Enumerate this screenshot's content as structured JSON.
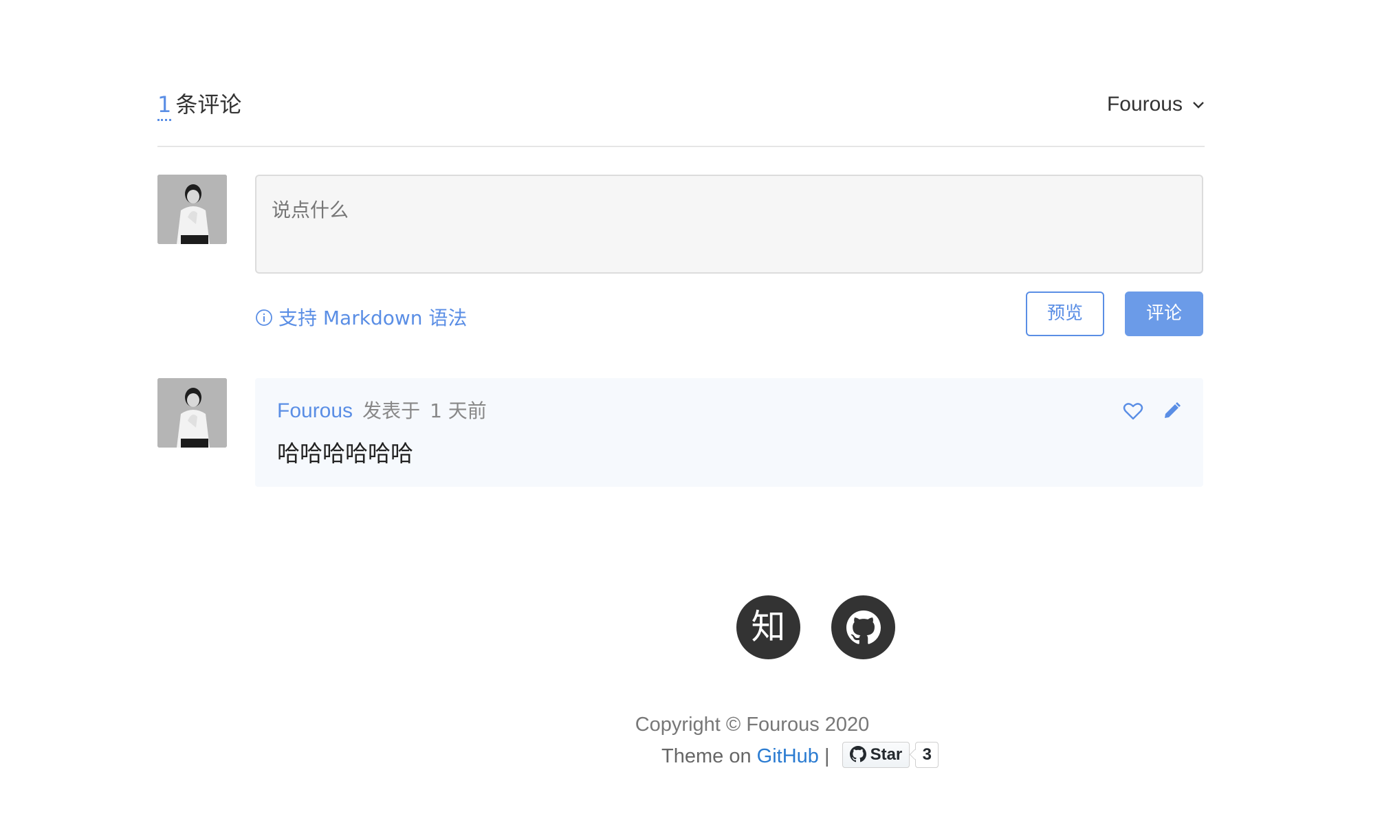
{
  "comments_header": {
    "count": "1",
    "count_suffix": "条评论",
    "user_name": "Fourous"
  },
  "editor": {
    "placeholder": "说点什么",
    "markdown_tip": "支持 Markdown 语法",
    "preview_label": "预览",
    "submit_label": "评论"
  },
  "comments": [
    {
      "author": "Fourous",
      "published_prefix": "发表于",
      "time": "1 天前",
      "body": "哈哈哈哈哈哈"
    }
  ],
  "social": {
    "zhihu_label": "知"
  },
  "footer": {
    "copyright": "Copyright © Fourous 2020",
    "theme_prefix": "Theme on",
    "theme_link": "GitHub",
    "separator": "|",
    "star_label": "Star",
    "star_count": "3"
  },
  "colors": {
    "accent": "#5a8ee5",
    "comment_bg": "#f6f9fd",
    "editor_bg": "#f6f6f6",
    "social_bg": "#333333"
  }
}
